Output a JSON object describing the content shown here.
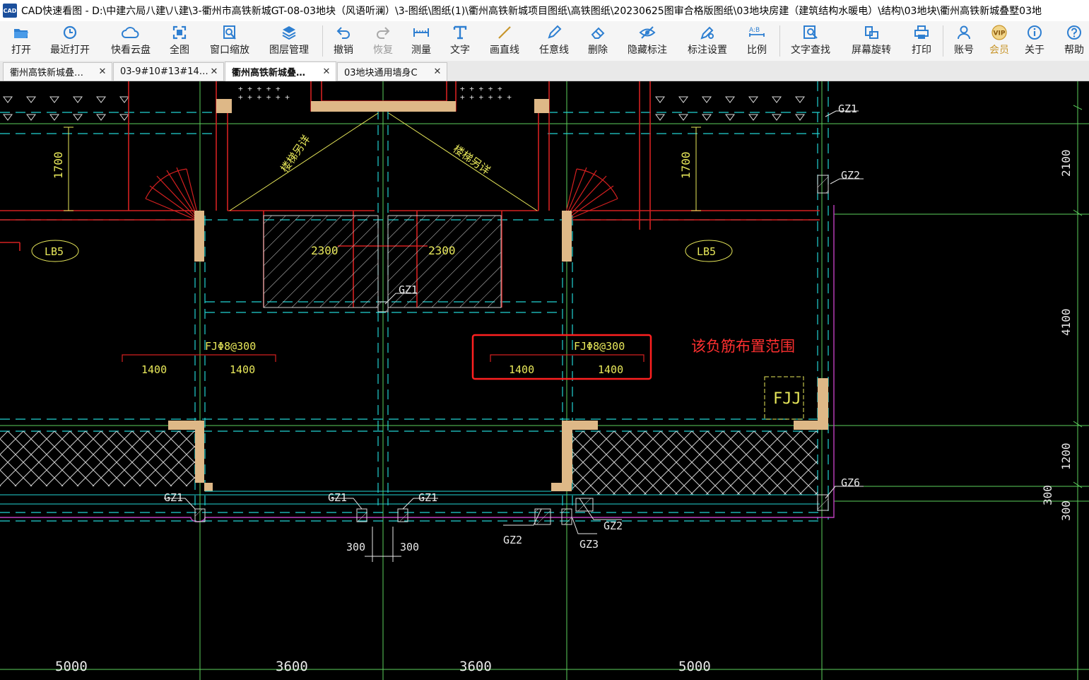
{
  "window": {
    "logo_text": "CAD",
    "title": "CAD快速看图 - D:\\中建六局八建\\八建\\3-衢州市高铁新城GT-08-03地块（风语听澜）\\3-图纸\\图纸(1)\\衢州高铁新城项目图纸\\高铁图纸\\20230625图审合格版图纸\\03地块房建（建筑结构水暖电）\\结构\\03地块\\衢州高铁新城叠墅03地"
  },
  "toolbar": {
    "open": "打开",
    "recent": "最近打开",
    "cloud": "快看云盘",
    "full_view": "全图",
    "window_zoom": "窗口缩放",
    "layers": "图层管理",
    "undo": "撤销",
    "redo": "恢复",
    "measure": "测量",
    "text": "文字",
    "line": "画直线",
    "freehand": "任意线",
    "delete": "删除",
    "hide_marks": "隐藏标注",
    "mark_settings": "标注设置",
    "scale": "比例",
    "text_search": "文字查找",
    "rotate": "屏幕旋转",
    "print": "打印",
    "account": "账号",
    "vip": "会员",
    "about": "关于",
    "help": "帮助",
    "vip_badge": "VIP",
    "scale_icon_text": "A:B"
  },
  "tabs": [
    {
      "label": "衢州高铁新城叠…",
      "active": false
    },
    {
      "label": "03-9#10#13#14…",
      "active": false
    },
    {
      "label": "衢州高铁新城叠…",
      "active": true
    },
    {
      "label": "03地块通用墙身C",
      "active": false
    }
  ],
  "tab_close": "✕",
  "drawing": {
    "stair_label_left": "楼梯另详",
    "stair_label_right": "楼梯另详",
    "slab_left": "LB5",
    "slab_right": "LB5",
    "dim_1700": "1700",
    "dim_2300": "2300",
    "rebar_label": "FJΦ8@300",
    "dim_1400": "1400",
    "fjj": "FJJ",
    "annotation_note": "该负筋布置范围",
    "gz1": "GZ1",
    "gz2": "GZ2",
    "gz3": "GZ3",
    "gz6": "GZ6",
    "dim_300": "300",
    "right_2100": "2100",
    "right_4100": "4100",
    "right_1200": "1200",
    "bottom_5000": "5000",
    "bottom_3600": "3600"
  },
  "colors": {
    "canvas_bg": "#000000",
    "cyan": "#22d3d3",
    "red": "#d42020",
    "green": "#5ccf5c",
    "yellow": "#e8e85a",
    "wall_fill": "#deb887",
    "magenta": "#c040c0",
    "highlight_box": "#ff2020"
  }
}
